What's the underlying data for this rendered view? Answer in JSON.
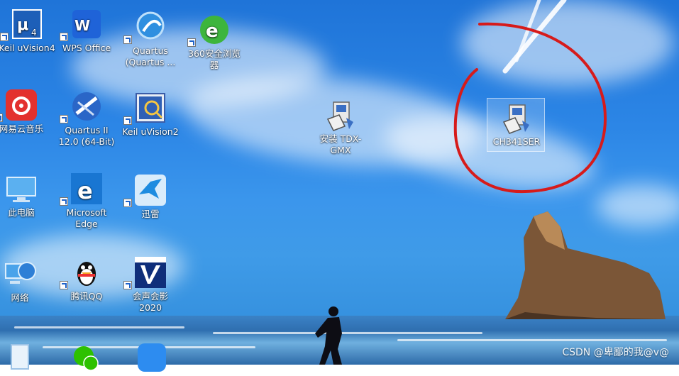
{
  "desktop": {
    "icons": [
      {
        "id": "keil4",
        "label": "Keil uVision4"
      },
      {
        "id": "wps",
        "label": "WPS Office"
      },
      {
        "id": "quartus-app",
        "label": "Quartus (Quartus ..."
      },
      {
        "id": "browser360",
        "label": "360安全浏览器"
      },
      {
        "id": "netease",
        "label": "网易云音乐"
      },
      {
        "id": "quartus2",
        "label": "Quartus II 12.0 (64-Bit)"
      },
      {
        "id": "keil2",
        "label": "Keil uVision2"
      },
      {
        "id": "tdx",
        "label": "安装 TDX-GMX"
      },
      {
        "id": "ch341",
        "label": "CH341SER"
      },
      {
        "id": "pc",
        "label": "此电脑"
      },
      {
        "id": "edge",
        "label": "Microsoft Edge"
      },
      {
        "id": "xunlei",
        "label": "迅雷"
      },
      {
        "id": "network",
        "label": "网络"
      },
      {
        "id": "qq",
        "label": "腾讯QQ"
      },
      {
        "id": "corel",
        "label": "会声会影 2020"
      }
    ]
  },
  "annotation": {
    "color": "#d61b1b"
  },
  "watermark": "CSDN @卑鄙的我@v@"
}
